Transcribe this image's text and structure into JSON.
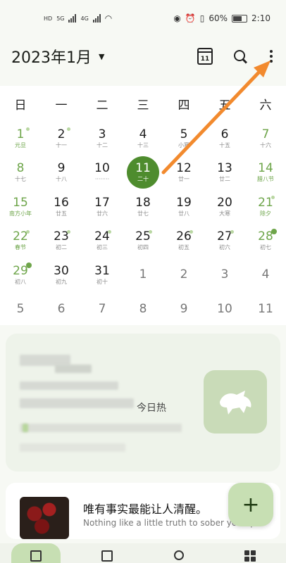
{
  "status_bar": {
    "network_label": "HD",
    "signal_label": "5G",
    "signal_label2": "4G",
    "battery_percent": "60%",
    "time": "2:10"
  },
  "header": {
    "title": "2023年1月",
    "calendar_icon_day": "11"
  },
  "calendar": {
    "weekdays": [
      "日",
      "一",
      "二",
      "三",
      "四",
      "五",
      "六"
    ],
    "days": [
      {
        "n": "1",
        "l": "元旦",
        "weekend": true,
        "holiday": true,
        "dot": "rest"
      },
      {
        "n": "2",
        "l": "十一",
        "dot": "rest"
      },
      {
        "n": "3",
        "l": "十二"
      },
      {
        "n": "4",
        "l": "十三"
      },
      {
        "n": "5",
        "l": "小寒"
      },
      {
        "n": "6",
        "l": "十五"
      },
      {
        "n": "7",
        "l": "十六",
        "weekend": true
      },
      {
        "n": "8",
        "l": "十七",
        "weekend": true
      },
      {
        "n": "9",
        "l": "十八"
      },
      {
        "n": "10",
        "l": "········"
      },
      {
        "n": "11",
        "l": "二十",
        "today": true
      },
      {
        "n": "12",
        "l": "廿一"
      },
      {
        "n": "13",
        "l": "廿二"
      },
      {
        "n": "14",
        "l": "腊八节",
        "weekend": true,
        "holiday": true
      },
      {
        "n": "15",
        "l": "南方小年",
        "weekend": true,
        "holiday": true
      },
      {
        "n": "16",
        "l": "廿五"
      },
      {
        "n": "17",
        "l": "廿六"
      },
      {
        "n": "18",
        "l": "廿七"
      },
      {
        "n": "19",
        "l": "廿八"
      },
      {
        "n": "20",
        "l": "大寒"
      },
      {
        "n": "21",
        "l": "除夕",
        "weekend": true,
        "holiday": true,
        "dot": "rest"
      },
      {
        "n": "22",
        "l": "春节",
        "weekend": true,
        "holiday": true,
        "dot": "rest"
      },
      {
        "n": "23",
        "l": "初二",
        "dot": "rest"
      },
      {
        "n": "24",
        "l": "初三",
        "dot": "rest"
      },
      {
        "n": "25",
        "l": "初四",
        "dot": "rest"
      },
      {
        "n": "26",
        "l": "初五",
        "dot": "rest"
      },
      {
        "n": "27",
        "l": "初六",
        "dot": "rest"
      },
      {
        "n": "28",
        "l": "初七",
        "weekend": true,
        "dot": "work"
      },
      {
        "n": "29",
        "l": "初八",
        "weekend": true,
        "dot": "work"
      },
      {
        "n": "30",
        "l": "初九"
      },
      {
        "n": "31",
        "l": "初十"
      },
      {
        "n": "1",
        "l": "",
        "next": true
      },
      {
        "n": "2",
        "l": "",
        "next": true
      },
      {
        "n": "3",
        "l": "",
        "next": true
      },
      {
        "n": "4",
        "l": "",
        "next": true
      },
      {
        "n": "5",
        "l": "",
        "next": true
      },
      {
        "n": "6",
        "l": "",
        "next": true
      },
      {
        "n": "7",
        "l": "",
        "next": true
      },
      {
        "n": "8",
        "l": "",
        "next": true
      },
      {
        "n": "9",
        "l": "",
        "next": true
      },
      {
        "n": "10",
        "l": "",
        "next": true
      },
      {
        "n": "11",
        "l": "",
        "next": true
      }
    ]
  },
  "card": {
    "caption": "今日热"
  },
  "quote": {
    "text": "唯有事实最能让人清醒。",
    "translation": "Nothing like a little truth to sober you up."
  },
  "fab": {
    "label": "+"
  },
  "colors": {
    "accent": "#4e8c2e",
    "annotation_arrow": "#f28a2e"
  }
}
